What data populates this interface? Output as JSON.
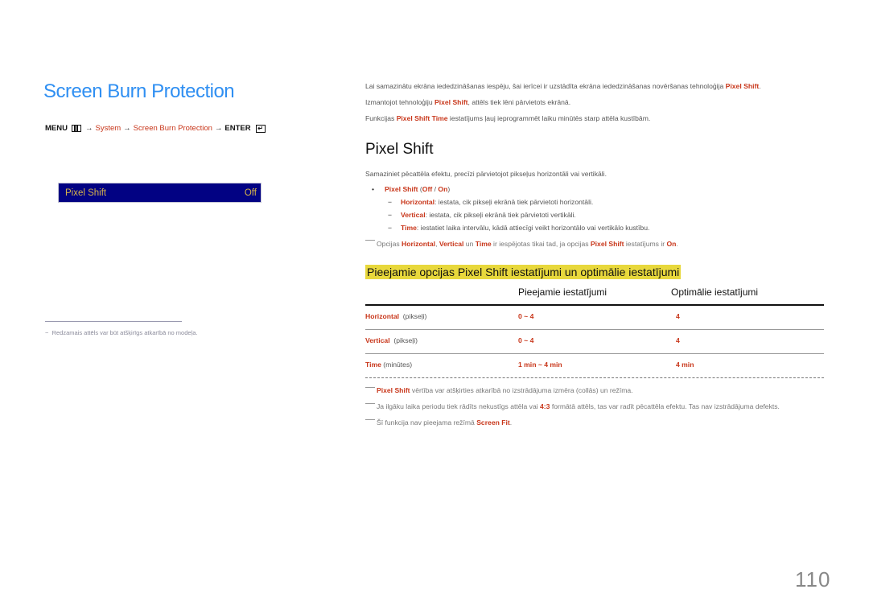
{
  "page_title": "Screen Burn Protection",
  "menu_path": {
    "menu": "MENU",
    "arrow": "→",
    "system": "System",
    "screen_burn": "Screen Burn Protection",
    "enter": "ENTER",
    "menu_icon": "menu-grid-icon",
    "enter_icon": "enter-icon"
  },
  "osd": {
    "label": "Pixel Shift",
    "value": "Off",
    "bg_color": "#020283",
    "text_color": "#d8b44a"
  },
  "left_footnote": "Redzamais attēls var būt atšķirīgs atkarībā no modeļa.",
  "intro": {
    "line1_a": "Lai samazinātu ekrāna iededzināšanas iespēju, šai ierīcei ir uzstādīta ekrāna iededzināšanas novēršanas tehnoloģija ",
    "line1_hl": "Pixel Shift",
    "line1_b": ".",
    "line2_a": "Izmantojot tehnoloģiju ",
    "line2_hl": "Pixel Shift",
    "line2_b": ", attēls tiek lēni pārvietots ekrānā.",
    "line3_a": "Funkcijas ",
    "line3_hl": "Pixel Shift Time",
    "line3_b": " iestatījums ļauj ieprogrammēt laiku minūtēs starp attēla kustībām."
  },
  "section": {
    "title": "Pixel Shift",
    "desc": "Samaziniet pēcattēla efektu, precīzi pārvietojot pikseļus horizontāli vai vertikāli.",
    "bullet": {
      "mark": "•",
      "label": "Pixel Shift",
      "open": " (",
      "off": "Off",
      "sep": " / ",
      "on": "On",
      "close": ")"
    },
    "sub_items": [
      {
        "mark": "−",
        "label": "Horizontal",
        "text": ": iestata, cik pikseļi ekrānā tiek pārvietoti horizontāli."
      },
      {
        "mark": "−",
        "label": "Vertical",
        "text": ": iestata, cik pikseļi ekrānā tiek pārvietoti vertikāli."
      },
      {
        "mark": "−",
        "label": "Time",
        "text": ": iestatiet laika intervālu, kādā attiecīgi veikt horizontālo vai vertikālo kustību."
      }
    ],
    "note": {
      "t1": "Opcijas ",
      "h1": "Horizontal",
      "t2": ", ",
      "h2": "Vertical",
      "t3": " un ",
      "h3": "Time",
      "t4": " ir iespējotas tikai tad, ja opcijas ",
      "h4": "Pixel Shift",
      "t5": " iestatījums ir ",
      "h5": "On",
      "t6": "."
    }
  },
  "table": {
    "title": "Pieejamie opcijas Pixel Shift iestatījumi un optimālie iestatījumi",
    "headers": [
      "",
      "Pieejamie iestatījumi",
      "Optimālie iestatījumi"
    ],
    "rows": [
      {
        "name": "Horizontal",
        "unit": "(pikseļi)",
        "available": "0 ~ 4",
        "optimal": "4"
      },
      {
        "name": "Vertical",
        "unit": "(pikseļi)",
        "available": "0 ~ 4",
        "optimal": "4"
      },
      {
        "name": "Time",
        "unit": "(minūtes)",
        "available": "1 min ~ 4 min",
        "optimal": "4 min"
      }
    ],
    "highlight_color": "#e8d83c"
  },
  "bottom_notes": [
    {
      "hl": "Pixel Shift",
      "text": " vērtība var atšķirties atkarībā no izstrādājuma izmēra (collās) un režīma."
    },
    {
      "t1": "Ja ilgāku laika periodu tiek rādīts nekustīgs attēla vai ",
      "hl": "4:3",
      "t2": " formātā attēls, tas var radīt pēcattēla efektu. Tas nav izstrādājuma defekts."
    },
    {
      "t1": "Šī funkcija nav pieejama režīmā ",
      "hl": "Screen Fit",
      "t2": "."
    }
  ],
  "page_number": "110",
  "colors": {
    "title_blue": "#2f8ff2",
    "highlight_red": "#c8361a"
  }
}
